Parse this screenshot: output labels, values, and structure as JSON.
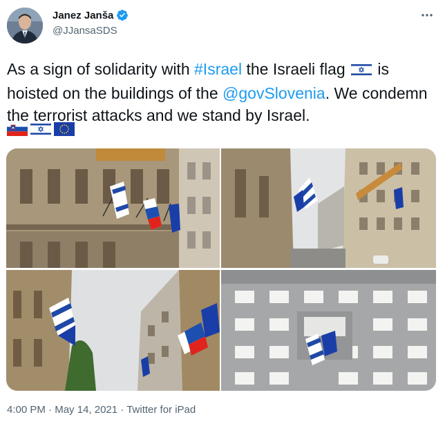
{
  "author": {
    "display_name": "Janez Janša",
    "handle": "@JJansaSDS",
    "verified_icon": "verified-badge-icon",
    "avatar_icon": "profile-avatar"
  },
  "tweet": {
    "text_part1": "As a sign of solidarity with ",
    "hashtag": "#Israel",
    "text_part2": " the Israeli flag ",
    "text_part3": " is hoisted on the buildings of the ",
    "mention": "@govSlovenia",
    "text_part4": ". We condemn the terrorist attacks and we stand by Israel.",
    "emoji_flags": [
      "slovenia-flag",
      "israel-flag",
      "eu-flag"
    ]
  },
  "media": {
    "photos": [
      {
        "name": "photo-building-facade-flags"
      },
      {
        "name": "photo-street-view-flags"
      },
      {
        "name": "photo-looking-up-flags"
      },
      {
        "name": "photo-office-building-flags"
      }
    ]
  },
  "meta": {
    "time": "4:00 PM",
    "separator": " · ",
    "date": "May 14, 2021",
    "source": "Twitter for iPad"
  },
  "colors": {
    "link": "#1d9bf0",
    "verified": "#1d9bf0",
    "secondary_text": "#536471"
  }
}
